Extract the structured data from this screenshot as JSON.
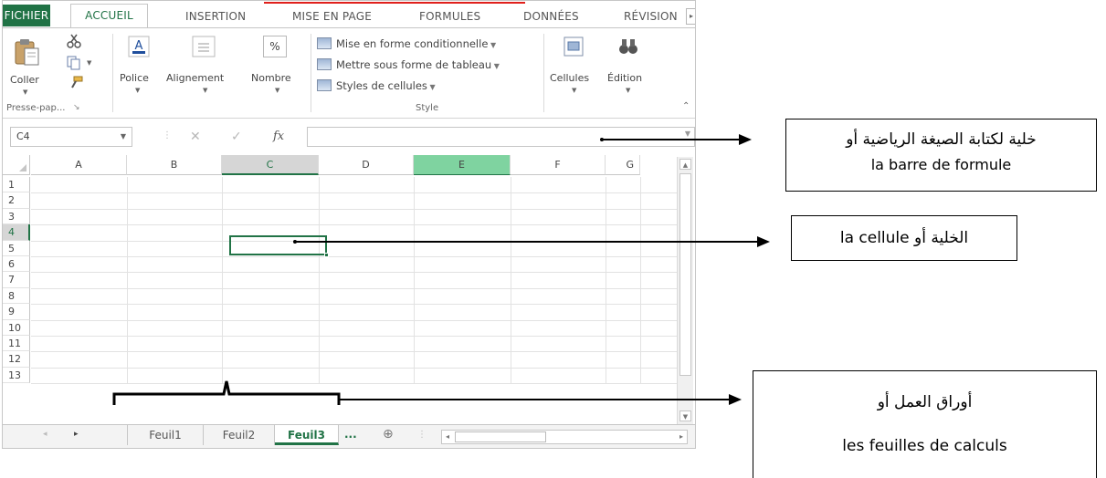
{
  "ribbon": {
    "tabs": {
      "file": "FICHIER",
      "home": "ACCUEIL",
      "insert": "INSERTION",
      "page_layout": "MISE EN PAGE",
      "formulas": "FORMULES",
      "data": "DONNÉES",
      "review": "RÉVISION"
    },
    "clipboard": {
      "paste_label": "Coller",
      "group_label": "Presse-pap..."
    },
    "font": {
      "label": "Police"
    },
    "alignment": {
      "label": "Alignement"
    },
    "number": {
      "label": "Nombre",
      "icon_glyph": "%"
    },
    "style": {
      "conditional_formatting": "Mise en forme conditionnelle",
      "format_as_table": "Mettre sous forme de tableau",
      "cell_styles": "Styles de cellules",
      "group_label": "Style"
    },
    "cells": {
      "label": "Cellules"
    },
    "editing": {
      "label": "Édition"
    }
  },
  "formula_bar": {
    "name_box": "C4",
    "cancel_glyph": "✕",
    "enter_glyph": "✓",
    "fx_label": "fx",
    "value": ""
  },
  "grid": {
    "columns": [
      "A",
      "B",
      "C",
      "D",
      "E",
      "F",
      "G"
    ],
    "rows": [
      "1",
      "2",
      "3",
      "4",
      "5",
      "6",
      "7",
      "8",
      "9",
      "10",
      "11",
      "12",
      "13"
    ],
    "selected_column": "C",
    "highlighted_column": "E",
    "selected_row": "4"
  },
  "sheets": {
    "tabs": [
      "Feuil1",
      "Feuil2",
      "Feuil3"
    ],
    "active": "Feuil3",
    "more_label": "...",
    "add_glyph": "⊕"
  },
  "annotations": {
    "formula_bar": {
      "line1": "خلية لكتابة الصيغة الرياضية أو",
      "line2": "la barre de formule"
    },
    "cell": {
      "text": "الخلية أو la cellule"
    },
    "sheets": {
      "line1": "أوراق العمل أو",
      "line2": "les feuilles de calculs"
    }
  },
  "colors": {
    "excel_green": "#217346",
    "highlight_green": "#7fd3a0",
    "tab_underline_red": "#e0201c",
    "annotation_black": "#000000"
  }
}
